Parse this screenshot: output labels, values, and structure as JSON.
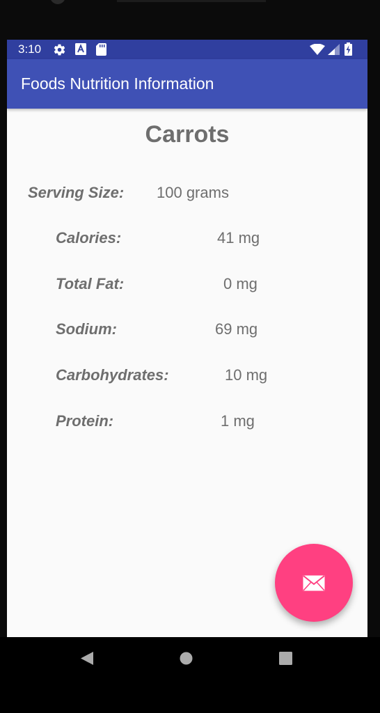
{
  "status_bar": {
    "time": "3:10",
    "icons": [
      "settings-icon",
      "text-icon",
      "sd-card-icon",
      "wifi-icon",
      "signal-icon",
      "battery-charging-icon"
    ],
    "background": "#303f9f"
  },
  "app_bar": {
    "title": "Foods Nutrition Information",
    "background": "#3f51b5"
  },
  "food": {
    "name": "Carrots",
    "serving_label": "Serving Size:",
    "serving_value": "100 grams",
    "nutrients": [
      {
        "label": "Calories:",
        "value": "41 mg"
      },
      {
        "label": "Total Fat:",
        "value": "0 mg"
      },
      {
        "label": "Sodium:",
        "value": "69 mg"
      },
      {
        "label": "Carbohydrates:",
        "value": "10 mg"
      },
      {
        "label": "Protein:",
        "value": "1 mg"
      }
    ]
  },
  "fab": {
    "icon": "email-icon",
    "color": "#ff4081"
  },
  "nav_bar": {
    "icons": [
      "back-icon",
      "home-icon",
      "recents-icon"
    ]
  }
}
